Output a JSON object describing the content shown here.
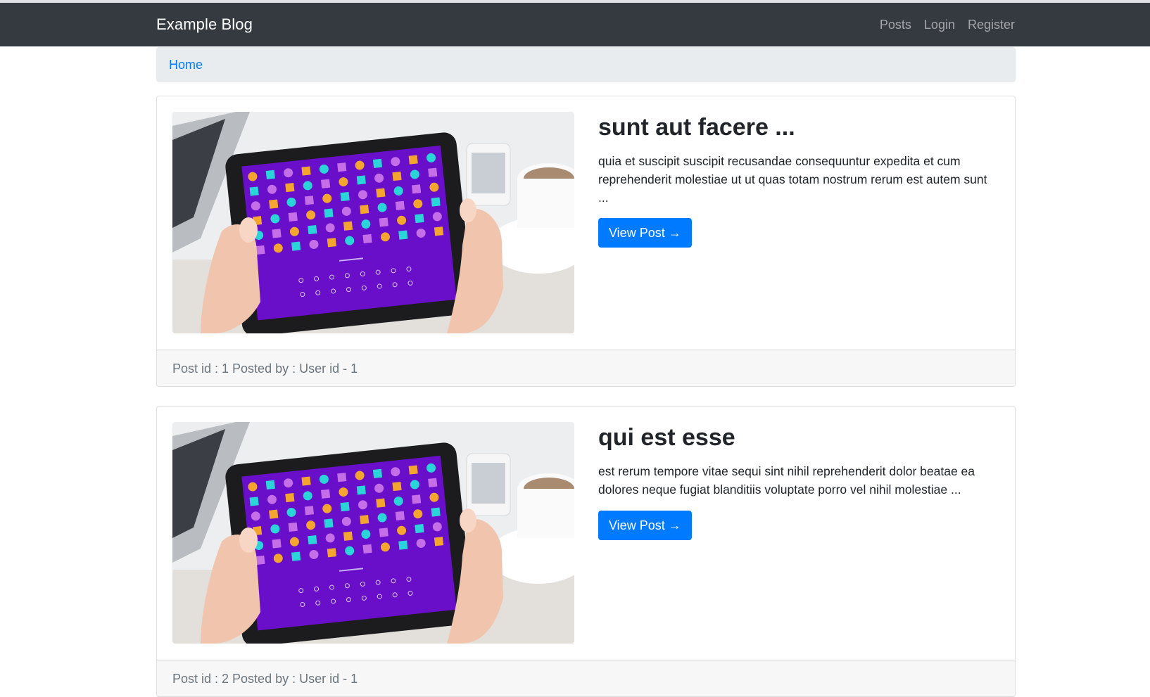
{
  "navbar": {
    "brand": "Example Blog",
    "links": [
      "Posts",
      "Login",
      "Register"
    ]
  },
  "breadcrumb": {
    "home": "Home"
  },
  "posts": [
    {
      "title": "sunt aut facere ...",
      "excerpt": "quia et suscipit suscipit recusandae consequuntur expedita et cum reprehenderit molestiae ut ut quas totam nostrum rerum est autem sunt ...",
      "button": "View Post →",
      "footer": "Post id : 1 Posted by : User id - 1"
    },
    {
      "title": "qui est esse",
      "excerpt": "est rerum tempore vitae sequi sint nihil reprehenderit dolor beatae ea dolores neque fugiat blanditiis voluptate porro vel nihil molestiae ...",
      "button": "View Post →",
      "footer": "Post id : 2 Posted by : User id - 1"
    }
  ],
  "colors": {
    "navbar": "#343a40",
    "primary": "#007bff",
    "breadcrumb_bg": "#e9ecef",
    "footer_bg": "#f7f7f7"
  }
}
